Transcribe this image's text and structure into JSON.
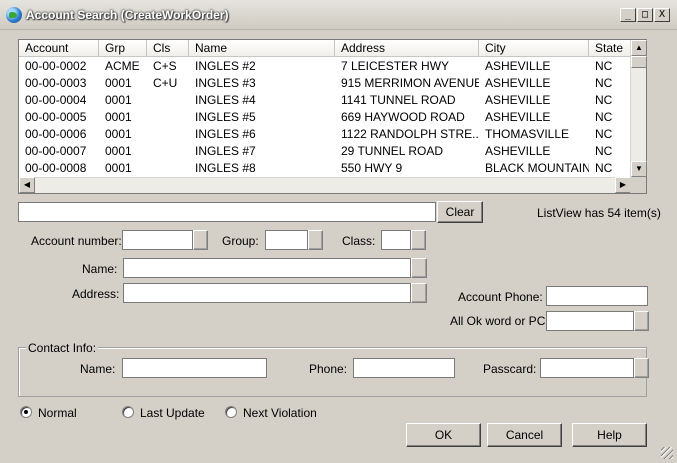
{
  "window": {
    "title": "Account Search (CreateWorkOrder)",
    "minimize": "_",
    "maximize": "□",
    "close": "X"
  },
  "list": {
    "columns": [
      "Account",
      "Grp",
      "Cls",
      "Name",
      "Address",
      "City",
      "State"
    ],
    "rows": [
      [
        "00-00-0002",
        "ACME",
        "C+S",
        "INGLES #2",
        "7 LEICESTER HWY",
        "ASHEVILLE",
        "NC"
      ],
      [
        "00-00-0003",
        "0001",
        "C+U",
        "INGLES #3",
        "915 MERRIMON AVENUE",
        "ASHEVILLE",
        "NC"
      ],
      [
        "00-00-0004",
        "0001",
        "",
        "INGLES #4",
        "1141 TUNNEL ROAD",
        "ASHEVILLE",
        "NC"
      ],
      [
        "00-00-0005",
        "0001",
        "",
        "INGLES #5",
        "669 HAYWOOD ROAD",
        "ASHEVILLE",
        "NC"
      ],
      [
        "00-00-0006",
        "0001",
        "",
        "INGLES #6",
        "1122 RANDOLPH STRE...",
        "THOMASVILLE",
        "NC"
      ],
      [
        "00-00-0007",
        "0001",
        "",
        "INGLES #7",
        "29 TUNNEL ROAD",
        "ASHEVILLE",
        "NC"
      ],
      [
        "00-00-0008",
        "0001",
        "",
        "INGLES #8",
        "550 HWY 9",
        "BLACK MOUNTAIN",
        "NC"
      ]
    ]
  },
  "filter": {
    "value": "",
    "clear_label": "Clear",
    "count_text": "ListView has 54 item(s)"
  },
  "form": {
    "account_number_label": "Account number:",
    "group_label": "Group:",
    "class_label": "Class:",
    "name_label": "Name:",
    "address_label": "Address:",
    "account_phone_label": "Account Phone:",
    "all_ok_label": "All Ok word or PC:"
  },
  "contact": {
    "legend": "Contact Info:",
    "name_label": "Name:",
    "phone_label": "Phone:",
    "passcard_label": "Passcard:"
  },
  "mode": {
    "options": [
      "Normal",
      "Last Update",
      "Next Violation"
    ],
    "selected": "Normal"
  },
  "buttons": {
    "ok": "OK",
    "cancel": "Cancel",
    "help": "Help"
  }
}
